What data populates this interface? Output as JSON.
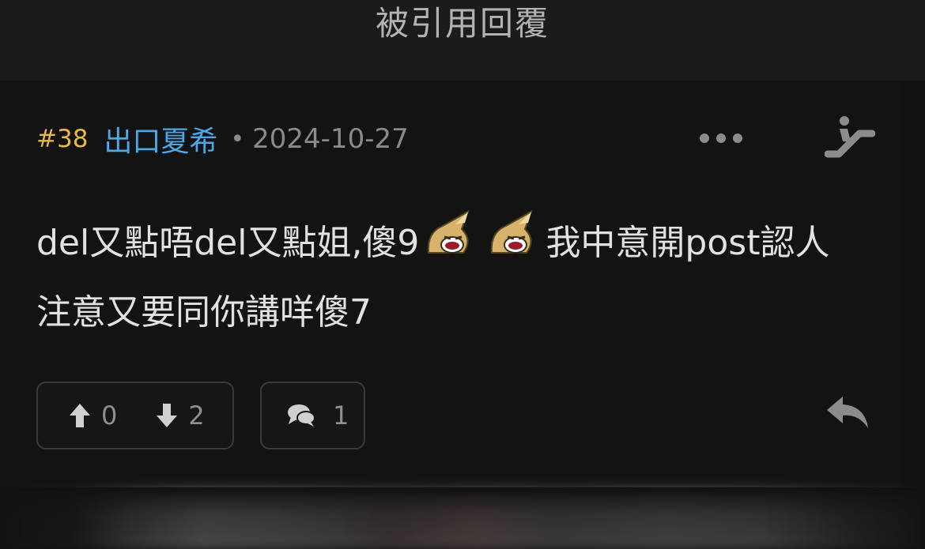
{
  "header": {
    "title": "被引用回覆"
  },
  "post": {
    "number": "#38",
    "author": "出口夏希",
    "separator": "•",
    "date": "2024-10-27",
    "body_segments": {
      "part1": "del又點唔del又點姐,傻9",
      "part2": "我中意開post認人注意又要同你講咩傻7"
    },
    "stickers": [
      "laughing-sticker",
      "laughing-sticker"
    ],
    "upvotes": "0",
    "downvotes": "2",
    "comments": "1"
  },
  "icons": {
    "more": "more-horizontal-icon",
    "escalator": "escalator-icon",
    "upvote": "arrow-up-icon",
    "downvote": "arrow-down-icon",
    "comment": "comments-icon",
    "reply": "reply-icon"
  },
  "colors": {
    "post_number": "#e8b84a",
    "author": "#4aa8e8",
    "background": "#111111",
    "text": "#e2e2e2",
    "muted": "#8a8a8a"
  }
}
